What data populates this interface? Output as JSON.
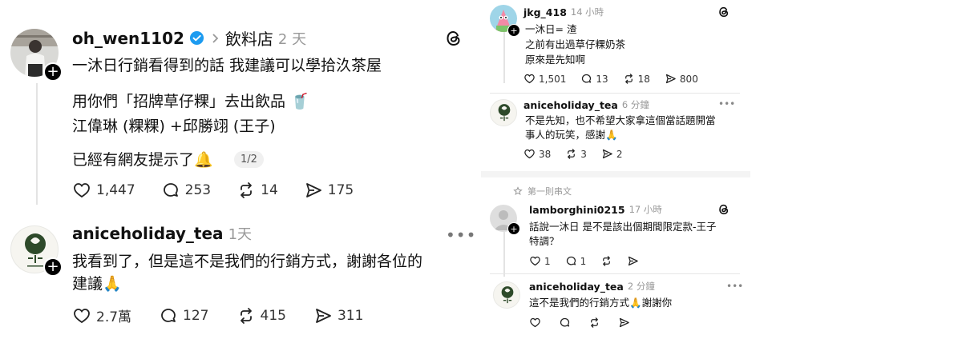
{
  "left": {
    "post": {
      "username": "oh_wen1102",
      "topic": "飲料店",
      "time": "2 天",
      "line1": "一沐日行銷看得到的話 我建議可以學拾汣茶屋",
      "line2": "用你們「招牌草仔粿」去出飲品 🥤",
      "line3": "江偉琳 (粿粿) +邱勝翊 (王子)",
      "line4": "已經有網友提示了🔔",
      "pager": "1/2",
      "likes": "1,447",
      "replies": "253",
      "reposts": "14",
      "shares": "175"
    },
    "reply": {
      "username": "aniceholiday_tea",
      "time": "1天",
      "line1": "我看到了，但是這不是我們的行銷方式，謝謝各位的",
      "line2": "建議🙏",
      "likes": "2.7萬",
      "replies": "127",
      "reposts": "415",
      "shares": "311"
    }
  },
  "right": {
    "post1": {
      "username": "jkg_418",
      "time": "14 小時",
      "line1": "一沐日= 渣",
      "line2": "之前有出過草仔粿奶茶",
      "line3": "原來是先知啊",
      "likes": "1,501",
      "replies": "13",
      "reposts": "18",
      "shares": "800"
    },
    "reply1": {
      "username": "aniceholiday_tea",
      "time": "6 分鐘",
      "line1": "不是先知，也不希望大家拿這個當話題開當",
      "line2": "事人的玩笑，感謝🙏",
      "likes": "38",
      "reposts": "3",
      "shares": "2"
    },
    "thread_label": "第一則串文",
    "post2": {
      "username": "lamborghini0215",
      "time": "17 小時",
      "line1": "話說一沐日 是不是該出個期間限定款-王子",
      "line2": "特調？",
      "likes": "1",
      "replies": "1"
    },
    "reply2": {
      "username": "aniceholiday_tea",
      "time": "2 分鐘",
      "line1": "這不是我們的行銷方式🙏謝謝你"
    }
  },
  "colors": {
    "verified": "#1d9bf0",
    "logo_green": "#2e4a2a"
  },
  "icons": [
    "heart-icon",
    "comment-icon",
    "repost-icon",
    "share-icon",
    "threads-logo-icon",
    "verified-badge-icon",
    "more-icon",
    "star-icon"
  ]
}
